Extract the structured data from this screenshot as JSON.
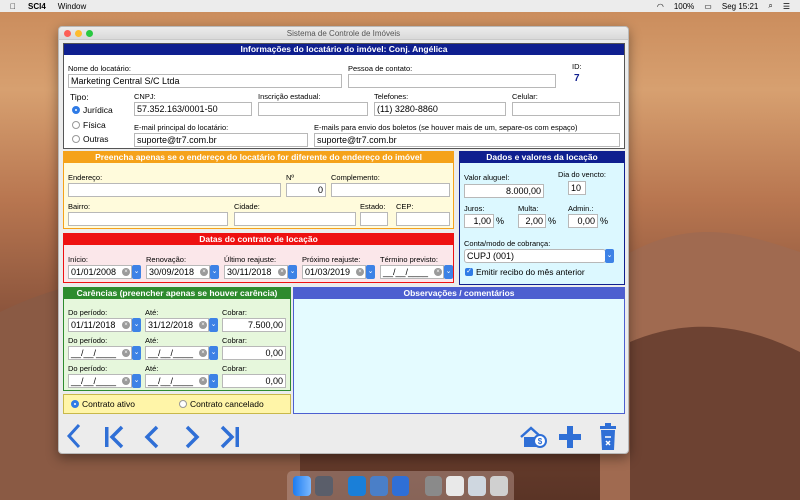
{
  "menubar": {
    "app": "SCI4",
    "menu1": "Window",
    "battery": "100%",
    "clock": "Seg 15:21"
  },
  "window": {
    "title": "Sistema de Controle de Imóveis"
  },
  "tenant": {
    "header": "Informações do locatário do imóvel: Conj. Angélica",
    "name_label": "Nome do locatário:",
    "name": "Marketing Central S/C Ltda",
    "contact_label": "Pessoa de contato:",
    "contact": "",
    "id_label": "ID:",
    "id": "7",
    "type_label": "Tipo:",
    "type_options": [
      "Jurídica",
      "Física",
      "Outras"
    ],
    "cnpj_label": "CNPJ:",
    "cnpj": "57.352.163/0001-50",
    "ie_label": "Inscrição estadual:",
    "ie": "",
    "phone_label": "Telefones:",
    "phone": "(11) 3280-8860",
    "cell_label": "Celular:",
    "cell": "",
    "email_label": "E-mail principal do locatário:",
    "email": "suporte@tr7.com.br",
    "emails_label": "E-mails para envio dos boletos (se houver mais de um, separe-os com espaço)",
    "emails": "suporte@tr7.com.br"
  },
  "address": {
    "header": "Preencha apenas se o endereço do locatário for diferente do endereço do imóvel",
    "street_label": "Endereço:",
    "street": "",
    "number_label": "Nº",
    "number": "0",
    "complement_label": "Complemento:",
    "complement": "",
    "district_label": "Bairro:",
    "district": "",
    "city_label": "Cidade:",
    "city": "",
    "state_label": "Estado:",
    "state": "",
    "zip_label": "CEP:",
    "zip": ""
  },
  "values": {
    "header": "Dados e valores da locação",
    "rent_label": "Valor aluguel:",
    "rent": "8.000,00",
    "due_label": "Dia do vencto:",
    "due": "10",
    "interest_label": "Juros:",
    "interest": "1,00",
    "fine_label": "Multa:",
    "fine": "2,00",
    "admin_label": "Admin.:",
    "admin": "0,00",
    "pct": "%",
    "billing_label": "Conta/modo de cobrança:",
    "billing": "CUPJ (001)",
    "receipt_label": "Emitir recibo do mês anterior"
  },
  "dates": {
    "header": "Datas do contrato de locação",
    "start_label": "Início:",
    "start": "01/01/2008",
    "renewal_label": "Renovação:",
    "renewal": "30/09/2018",
    "last_adj_label": "Último reajuste:",
    "last_adj": "30/11/2018",
    "next_adj_label": "Próximo reajuste:",
    "next_adj": "01/03/2019",
    "end_label": "Término previsto:",
    "end": "__/__/____"
  },
  "grace": {
    "header": "Carências (preencher apenas se houver carência)",
    "from_label": "Do período:",
    "to_label": "Até:",
    "charge_label": "Cobrar:",
    "rows": [
      {
        "from": "01/11/2018",
        "to": "31/12/2018",
        "charge": "7.500,00"
      },
      {
        "from": "__/__/____",
        "to": "__/__/____",
        "charge": "0,00"
      },
      {
        "from": "__/__/____",
        "to": "__/__/____",
        "charge": "0,00"
      }
    ]
  },
  "status": {
    "active": "Contrato ativo",
    "cancelled": "Contrato cancelado"
  },
  "notes": {
    "header": "Observações / comentários",
    "text": ""
  },
  "colors": {
    "blue_header": "#0f1f8f",
    "orange": "#f5a21a",
    "red": "#ee1111",
    "green": "#2e8b2e",
    "purple_blue": "#4d5fd0",
    "yellow_bg": "#fffbdc",
    "cyan_bg": "#dcf8ff",
    "pink_bg": "#fbe7ea",
    "green_bg": "#e6f7dc"
  }
}
